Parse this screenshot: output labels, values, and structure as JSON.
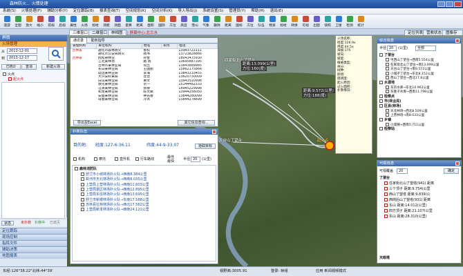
{
  "window": {
    "title": "森林防火... 火情处理"
  },
  "menu": [
    "系统(S)",
    "火情处理(F)",
    "辅助分析(Y)",
    "定位跟踪(B)",
    "报表查询(T)",
    "空间规划(K)",
    "空间分析(K)",
    "导入导出(J)",
    "系统设置(S)",
    "管理员(Y)",
    "帮助(H)",
    "退出(E)"
  ],
  "toolbar": [
    "漫游",
    "全图",
    "放大",
    "缩小",
    "前视",
    "后视",
    "属性",
    "火场",
    "标绘",
    "测距",
    "测面",
    "量算",
    "距离",
    "面积",
    "国际",
    "方位",
    "高度",
    "雪山",
    "气象",
    "删除",
    "距离",
    "国标",
    "方位",
    "队伍",
    "物资",
    "标绘",
    "转换",
    "可视",
    "出图",
    "快照",
    "卫星",
    "检测",
    "统计"
  ],
  "tabs": [
    "三维窗口",
    "二维窗口",
    "林相图"
  ],
  "map_header": "| 屏幕中心:北兰水",
  "right_tabs": [
    "定位列表",
    "营救状态",
    "图像存档"
  ],
  "left": {
    "header": "屏图",
    "fire_label": "火场管理",
    "date_from": "2013-12-01",
    "date_to": "2013-12-17",
    "btn_today": "已统计",
    "btn_query": "查询",
    "btn_new": "新建火场",
    "tree_root": "火点",
    "tree_child": "起火点",
    "legend": [
      "状态",
      "未扑救",
      "扑救中",
      "已熄灭"
    ],
    "nav": [
      "定位跟踪",
      "现场控制",
      "指挥文件",
      "辅助决策",
      "地图报表"
    ]
  },
  "contacts": {
    "tabs": [
      "通讯录",
      "勤务指导"
    ],
    "headers": [
      "管理机构",
      "单位机构",
      "姓名",
      "职务",
      "电话"
    ],
    "group": "吉林省",
    "rows": [
      [
        "吉林省",
        "通化市森林防火",
        "鲁权",
        "",
        "13943722111"
      ],
      [
        "",
        "通化市公安局防火",
        "隋书",
        "",
        "13723828866"
      ],
      [
        "吉林省",
        "抚松县林业",
        "孙金 ",
        "",
        "18043475930"
      ],
      [
        "",
        "江北某林场",
        "路 晓",
        "",
        "13695887395"
      ],
      [
        "",
        "吉林市某林业局",
        "何立",
        "",
        "13843889985"
      ],
      [
        "",
        "长白某林业局",
        "王国丽",
        "",
        "15862175866"
      ],
      [
        "",
        "延边某林业局",
        "李海",
        "",
        "13843233455"
      ],
      [
        "",
        "大兴安岭某局",
        "佳佳",
        "",
        "13620730009"
      ],
      [
        "",
        "白山某林业局",
        "黄文",
        "",
        "13943520998"
      ],
      [
        "",
        "敦化某林业局",
        "宗一",
        "",
        "15144482333"
      ],
      [
        "",
        "汪清某林业局",
        "张敬",
        "",
        "18945229998"
      ],
      [
        "",
        "和龙某林业局",
        "陈文斌",
        "",
        "13944258050"
      ],
      [
        "",
        "安图某林业局",
        "钟光春",
        "",
        "13844280099"
      ],
      [
        "",
        "珲春某林业局",
        "冷冰",
        "",
        "15844278899"
      ]
    ],
    "export_btn": "导出至Excel",
    "other_btn": "其它信息查询..."
  },
  "rescue": {
    "title": "扑救队伍",
    "target_label": "目的地:",
    "lon": "经度:127-6-36.11",
    "lat": "纬度:44-9-33.07",
    "pick_btn": "拾取目标",
    "filters": [
      "机构",
      "摩托",
      "直升机",
      "行车路线"
    ],
    "radius_label": "半径",
    "radius_value": "20",
    "radius_unit": "(公里)",
    "opt1": "最佳",
    "opt2": "最快",
    "root": "森林消防队",
    "items": [
      "舒兰市小城林场扑火队→西南8.384公里",
      "蛟河市天北林场扑火队→西南8.035公里",
      "上营局上营林场扑火队→西南11.603公里",
      "上营局富区林场扑火队→西南12.895公里",
      "上营局东信林场扑火队→西南13.695公里",
      "舒兰市新楼林场扑火队→东南17.588公里",
      "苏林县拉林林场扑火队→西北17.562公里",
      "上营局新发林场扑火队→西南24.121公里"
    ]
  },
  "info_popup": {
    "lines": [
      "火场名称:",
      "经度:126.9x",
      "纬度:44.5x",
      "海拔:175",
      "坡向:",
      "坡度:",
      "植被类型:",
      "林分:",
      "树种:",
      "龄组:",
      "郁闭度:",
      "起火原因:",
      "过火面积:",
      "扑救情况:"
    ]
  },
  "map_labels": {
    "p1": "四家街北山了望台",
    "d1": "距离:13.099(公里)",
    "a1": "方位:160(度)",
    "d2": "距离:9.572(公里)",
    "a2": "方位:188(度)",
    "p2": "天台山了望台",
    "fire": "起火点"
  },
  "nav_panel": {
    "title": "综合信息",
    "radius_label": "半径",
    "radius_value": "20",
    "unit": "(公里)",
    "all": "全部",
    "groups": [
      {
        "name": "了望台",
        "items": [
          "屯西山了望台→西南5.554公里",
          "在家街北山了望台→南13.099公里",
          "天台山了望台→南9.572公里",
          "小城子了望台→东北8.152公里",
          "西山了望台→西北17.8公里"
        ]
      },
      {
        "name": "水源地",
        "items": [
          "东京水库→东北10.962公里",
          "东胜子水库→西南11.798公里"
        ]
      },
      {
        "name": "检察点",
        "items": []
      },
      {
        "name": "市(林业局)",
        "items": []
      },
      {
        "name": "区县(林场)",
        "items": [
          "天北林场→西北8.509公里",
          "上营林场→南8.033公里"
        ]
      },
      {
        "name": "乡镇",
        "items": [
          "小城镇→西南5.711公里"
        ]
      },
      {
        "name": "检察站",
        "items": []
      }
    ]
  },
  "resource_panel": {
    "title": "可视信息",
    "label": "可视覆盖",
    "value": "20",
    "btn": "确定",
    "group": "了望台",
    "items": [
      "任家街北山了望塔(941) 距离",
      "三个顶子 距离:9.754(公里",
      "西山了望塔 距离:9.839(公",
      "西岗后山了望塔(931) 距离",
      "东山 距离:14.012(公里)",
      "四方顶子 距离:21.107(公里",
      "东山 距离:28.310(公里)"
    ],
    "group2": "天眼塔"
  },
  "status": {
    "coords": "东经:126°38.22\"北纬:44°39'",
    "view": "视野高:3005.91",
    "login": "登录: 帧组",
    "mode": "应用 新闻视频模式"
  }
}
